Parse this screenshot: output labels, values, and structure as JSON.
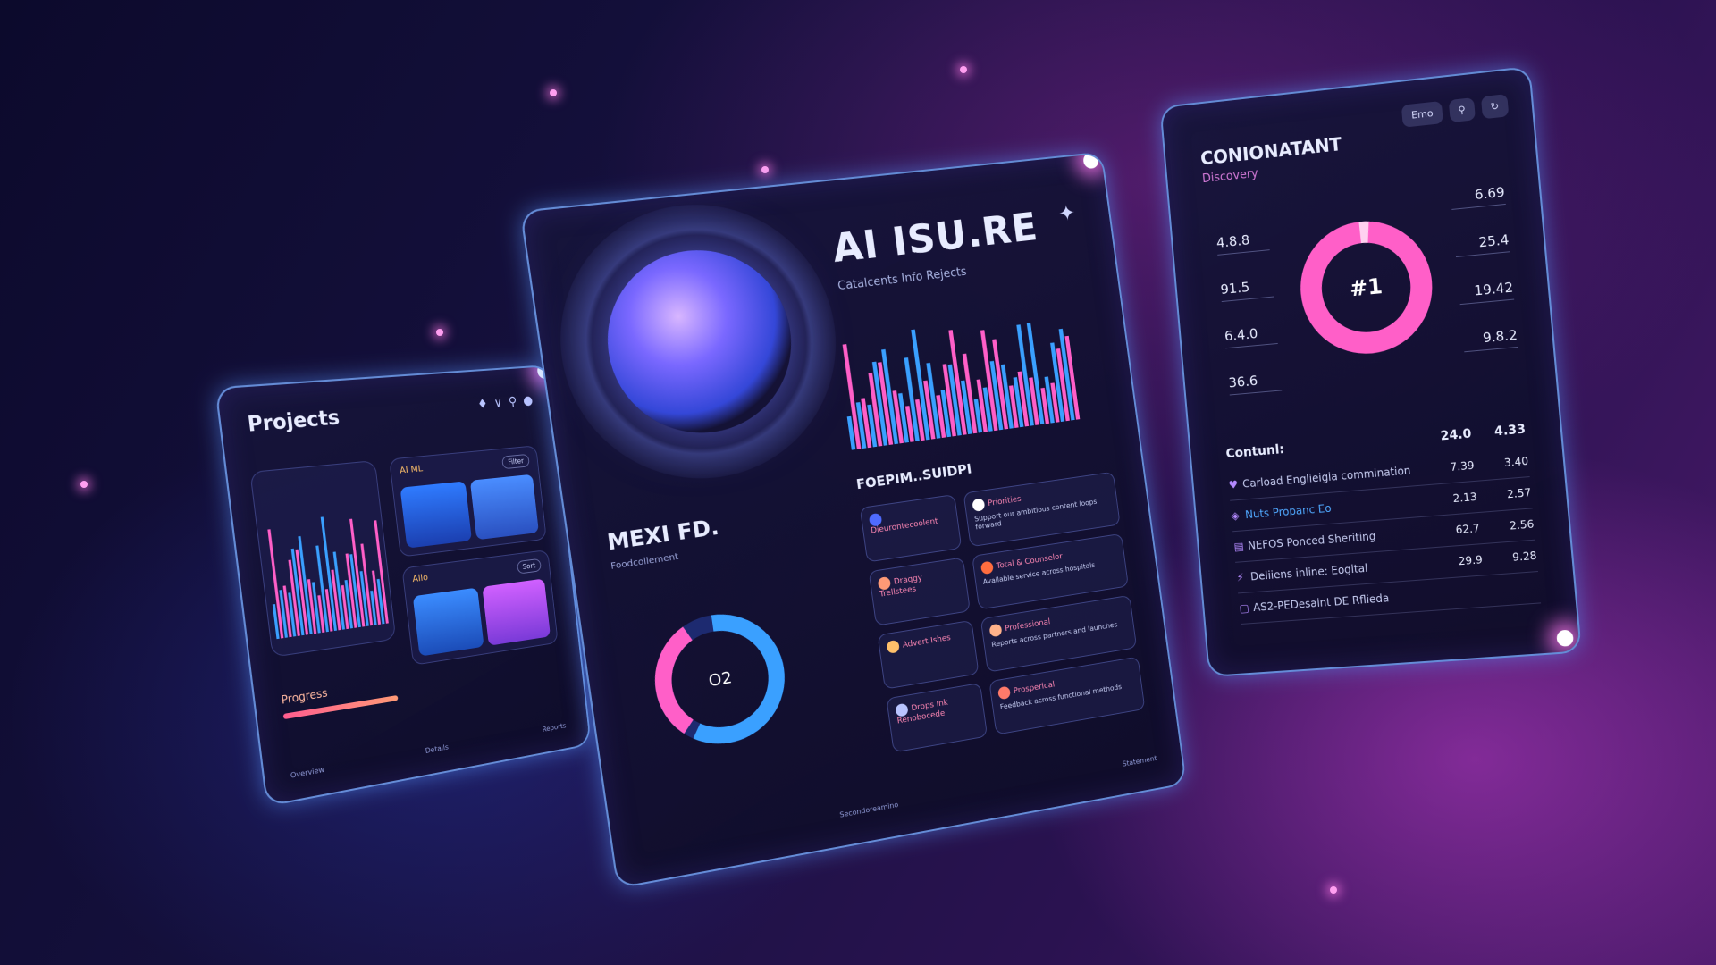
{
  "left_panel": {
    "title": "Projects",
    "icons": [
      "bell-icon",
      "filter-icon",
      "search-icon",
      "user-icon"
    ],
    "card1": {
      "header": "AI ML",
      "pill": "Filter"
    },
    "card2": {
      "header": "Allo",
      "pill": "Sort"
    },
    "progress_label": "Progress",
    "progress_value": 0.85,
    "footer": [
      "Overview",
      "Details",
      "Reports"
    ]
  },
  "center_panel": {
    "title": "AI ISU.RE",
    "subtitle": "Catalcents Info Rejects",
    "left_title": "MEXI FD.",
    "left_subtitle": "Foodcollement",
    "donut_center": "O2",
    "section_title": "FOEPIM..SUIDPI",
    "feed": [
      {
        "title": "Dieurontecoolent",
        "body": "",
        "color": "#4f6bff"
      },
      {
        "title": "Priorities",
        "body": "Support our ambitious content loops forward",
        "color": "#ffffff"
      },
      {
        "title": "Draggy Trellstees",
        "body": "",
        "color": "#ff9a76"
      },
      {
        "title": "Total & Counselor",
        "body": "Available service across hospitals",
        "color": "#ff6d3f"
      },
      {
        "title": "Advert Ishes",
        "body": "",
        "color": "#ffc06a"
      },
      {
        "title": "Professional",
        "body": "Reports across partners and launches",
        "color": "#ffb28a"
      },
      {
        "title": "Drops Ink Renobocede",
        "body": "",
        "color": "#b9c4ff"
      },
      {
        "title": "Prosperical",
        "body": "Feedback across functional methods",
        "color": "#ff7a6a"
      }
    ],
    "footer": [
      "Secondoreamino",
      "Statement"
    ],
    "corner_icon": "sparkle-icon"
  },
  "right_panel": {
    "title": "CONIONATANT",
    "subtitle": "Discovery",
    "toolbar": {
      "label": "Emo",
      "search_icon": "search-icon",
      "refresh_icon": "refresh-icon"
    },
    "donut_label": "#1",
    "left_values": [
      "4.8.8",
      "91.5",
      "6.4.0",
      "36.6"
    ],
    "right_values": [
      "6.69",
      "25.4",
      "19.42",
      "9.8.2"
    ],
    "table_header": {
      "label": "Contunl:",
      "col1": "24.0",
      "col2": "4.33"
    },
    "table_rows": [
      {
        "icon": "heart-icon",
        "name": "Carload Englieigia commination",
        "v1": "7.39",
        "v2": "3.40"
      },
      {
        "icon": "shield-icon",
        "name": "Nuts Propanc Eo",
        "v1": "2.13",
        "v2": "2.57"
      },
      {
        "icon": "doc-icon",
        "name": "NEFOS Ponced Sheriting",
        "v1": "62.7",
        "v2": "2.56"
      },
      {
        "icon": "bolt-icon",
        "name": "Deliiens inline: Eogital",
        "v1": "29.9",
        "v2": "9.28"
      },
      {
        "icon": "box-icon",
        "name": "AS2-PEDesaint DE Rflieda",
        "v1": "",
        "v2": ""
      }
    ]
  },
  "colors": {
    "accent_pink": "#ff5fc8",
    "accent_blue": "#3aa0ff",
    "panel_border": "#78aaff"
  }
}
